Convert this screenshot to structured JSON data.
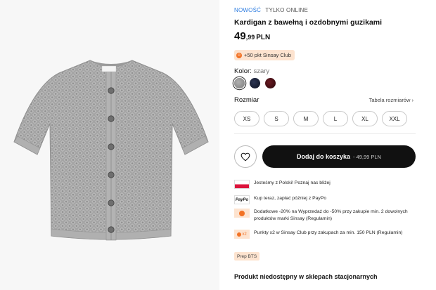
{
  "badges": {
    "new": "NOWOŚĆ",
    "online": "TYLKO ONLINE"
  },
  "product": {
    "title": "Kardigan z bawełną i ozdobnymi guzikami",
    "price_int": "49",
    "price_dec": ",99",
    "price_currency": "PLN",
    "club_points": "+50 pkt Sinsay Club"
  },
  "color": {
    "label": "Kolor:",
    "value": "szary",
    "swatches": [
      "grey",
      "navy",
      "burgundy"
    ]
  },
  "size": {
    "label": "Rozmiar",
    "guide": "Tabela rozmiarów",
    "options": [
      "XS",
      "S",
      "M",
      "L",
      "XL",
      "XXL"
    ]
  },
  "cart": {
    "label": "Dodaj do koszyka",
    "price": "49,99 PLN"
  },
  "features": [
    {
      "icon": "poland-flag-icon",
      "text": "Jesteśmy z Polski! Poznaj nas bliżej"
    },
    {
      "icon": "paypo-icon",
      "text": "Kup teraz, zapłać później z PayPo"
    },
    {
      "icon": "sale-icon",
      "text": "Dodatkowe -20% na Wyprzedaż do -50% przy zakupie min. 2 dowolnych produktów marki Sinsay (Regulamin)"
    },
    {
      "icon": "points-x2-icon",
      "text": "Punkty x2 w Sinsay Club przy zakupach za min. 150 PLN (Regulamin)"
    }
  ],
  "x2_label": "x2",
  "paypo_label": "PayPo",
  "tag": "Prep BTS",
  "stock": "Produkt niedostępny w sklepach stacjonarnych",
  "colors": {
    "accent_orange": "#f27224",
    "badge_blue": "#2e7de1",
    "cta_black": "#111111"
  }
}
